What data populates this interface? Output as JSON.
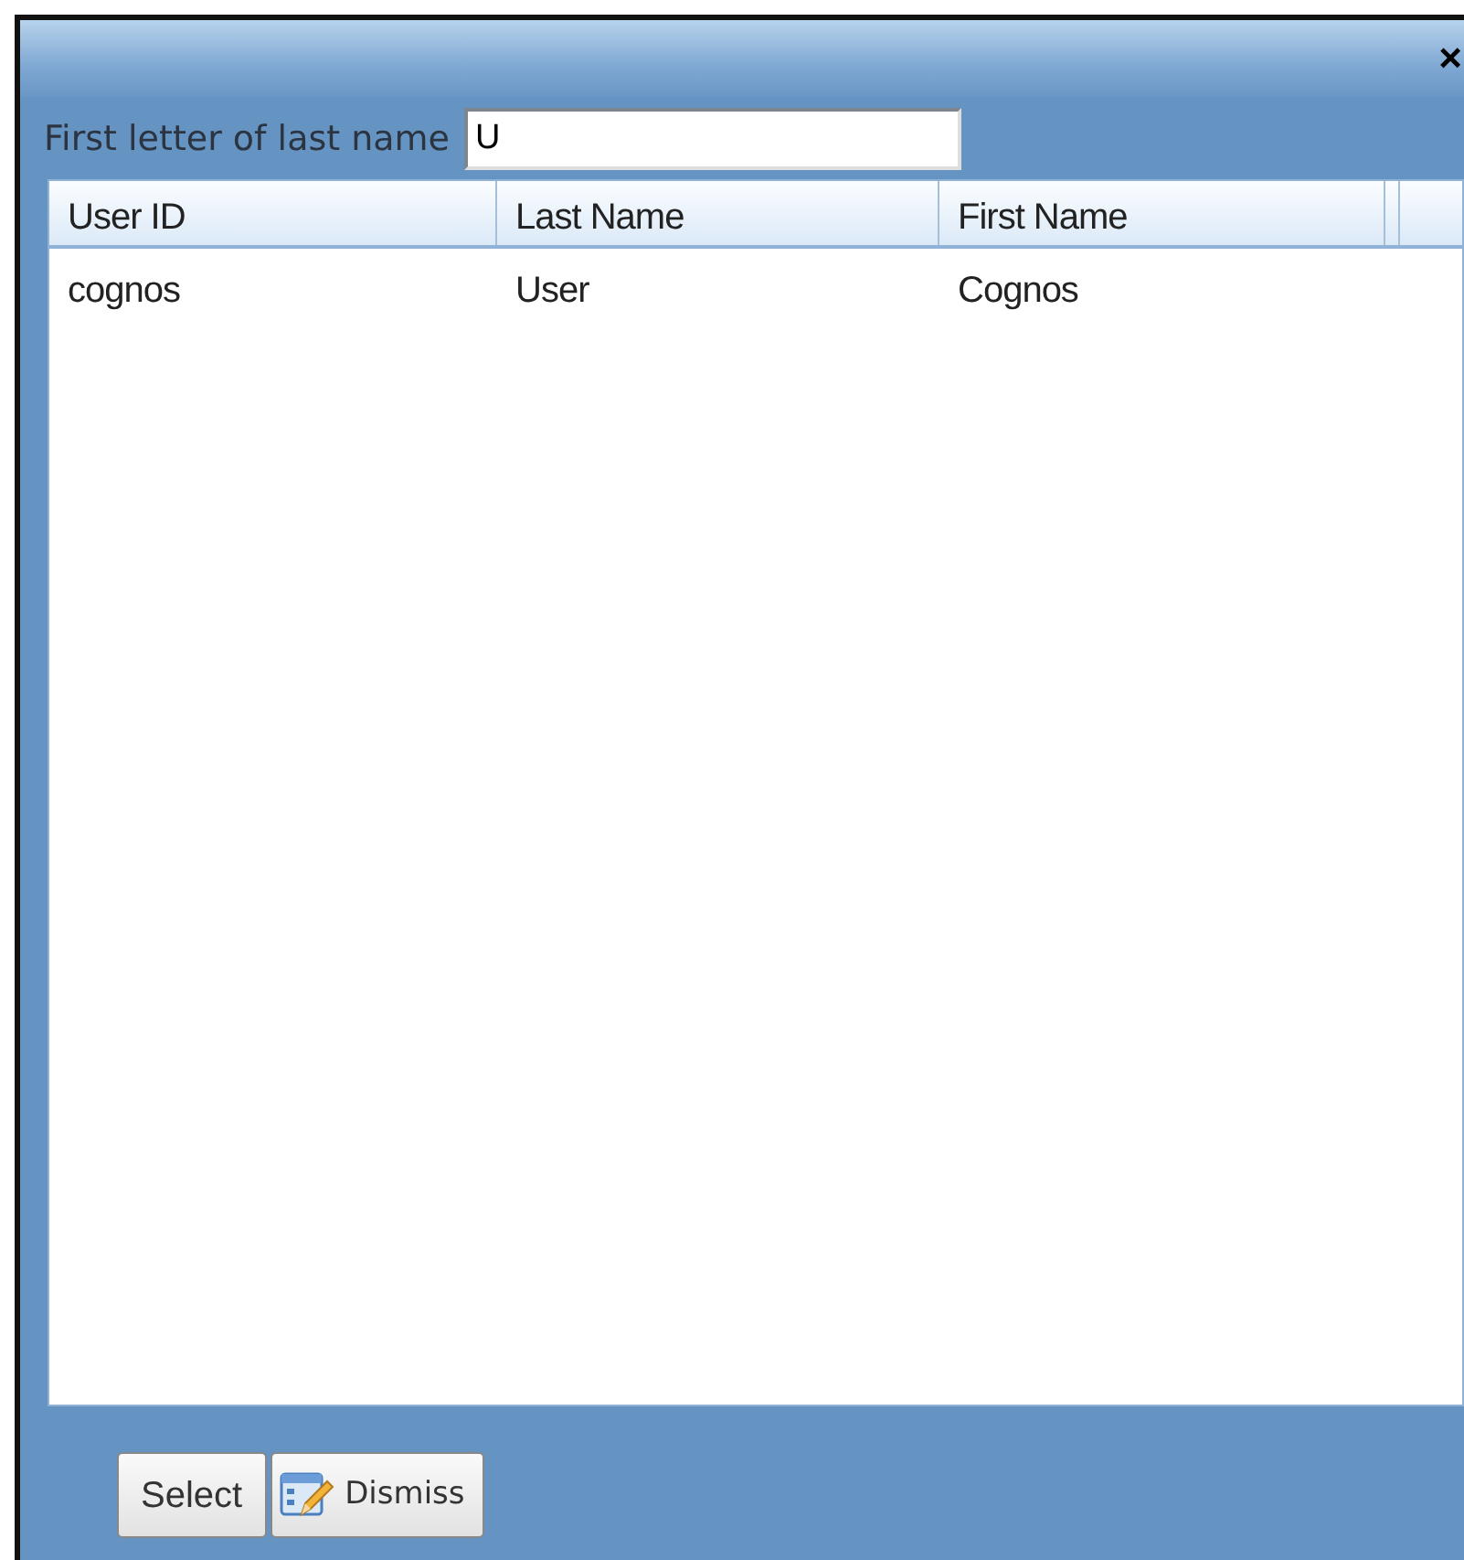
{
  "window": {
    "close": "×"
  },
  "filter": {
    "label": "First letter of last name",
    "value": "U"
  },
  "table": {
    "columns": [
      "User ID",
      "Last Name",
      "First Name"
    ],
    "rows": [
      [
        "cognos",
        "User",
        "Cognos"
      ]
    ]
  },
  "buttons": [
    {
      "label": "Select",
      "kind": "plain"
    },
    {
      "label": "Dismiss",
      "kind": "icon"
    }
  ]
}
